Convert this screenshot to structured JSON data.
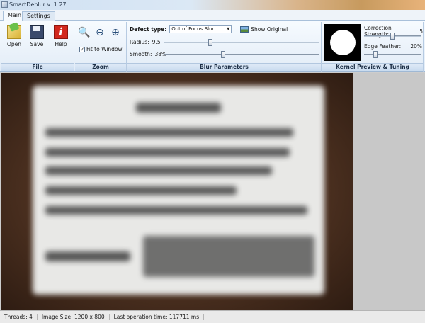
{
  "window": {
    "title": "SmartDeblur v. 1.27"
  },
  "tabs": [
    {
      "label": "Main",
      "active": true
    },
    {
      "label": "Settings",
      "active": false
    }
  ],
  "ribbon": {
    "file": {
      "label": "File",
      "buttons": [
        {
          "label": "Open",
          "icon": "open-folder-icon"
        },
        {
          "label": "Save",
          "icon": "floppy-disk-icon"
        },
        {
          "label": "Help",
          "icon": "help-icon"
        }
      ]
    },
    "zoom": {
      "label": "Zoom",
      "buttons": [
        {
          "icon": "zoom-icon",
          "glyph": "🔍"
        },
        {
          "icon": "zoom-out-icon",
          "glyph": "⊖"
        },
        {
          "icon": "zoom-in-icon",
          "glyph": "⊕"
        }
      ],
      "fit_to_window": {
        "label": "Fit to Window",
        "checked": true
      }
    },
    "blur": {
      "label": "Blur Parameters",
      "defect_type_label": "Defect type:",
      "defect_type_value": "Out of Focus Blur",
      "show_original_label": "Show Original",
      "radius": {
        "label": "Radius:",
        "value": "9.5",
        "fraction": 0.3
      },
      "smooth": {
        "label": "Smooth:",
        "value": "38%",
        "fraction": 0.38
      }
    },
    "kernel": {
      "label": "Kernel Preview & Tuning",
      "correction_strength": {
        "label": "Correction Strength:",
        "value": "5",
        "fraction": 0.5
      },
      "edge_feather": {
        "label": "Edge Feather:",
        "value": "20%",
        "fraction": 0.2
      }
    }
  },
  "status": {
    "threads": "Threads: 4",
    "image_size": "Image Size: 1200 x 800",
    "last_op": "Last operation time: 117711 ms"
  },
  "colors": {
    "ribbon_bg": "#e2ecf7",
    "group_label_bg": "#c9dbef",
    "photo_frame": "#4a2f1f",
    "paper": "#e8e8e6"
  }
}
